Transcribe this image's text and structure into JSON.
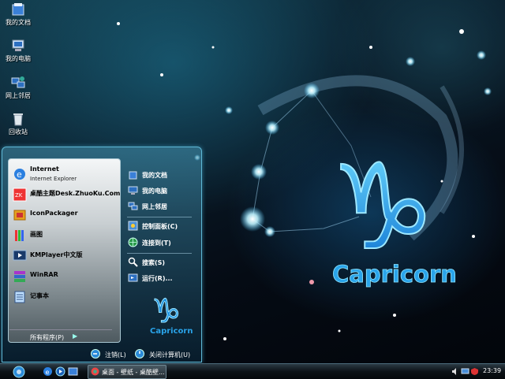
{
  "desktop": {
    "icons": [
      {
        "label": "我的文档",
        "icon": "my-documents-icon"
      },
      {
        "label": "我的电脑",
        "icon": "my-computer-icon"
      },
      {
        "label": "网上邻居",
        "icon": "network-places-icon"
      },
      {
        "label": "回收站",
        "icon": "recycle-bin-icon"
      }
    ],
    "wallpaper": {
      "title": "Capricorn",
      "glyph": "♑"
    }
  },
  "start_menu": {
    "programs": [
      {
        "name": "Internet",
        "sub": "Internet Explorer",
        "icon": "internet-explorer-icon"
      },
      {
        "name": "桌酷主题Desk.ZhuoKu.Com",
        "icon": "zhuoku-theme-icon"
      },
      {
        "name": "IconPackager",
        "icon": "iconpackager-icon"
      },
      {
        "name": "画图",
        "icon": "paint-icon"
      },
      {
        "name": "KMPlayer中文版",
        "icon": "kmplayer-icon"
      },
      {
        "name": "WinRAR",
        "icon": "winrar-icon"
      },
      {
        "name": "记事本",
        "icon": "notepad-icon"
      }
    ],
    "all_programs": "所有程序(P)",
    "right_items": [
      {
        "label": "我的文档",
        "icon": "my-documents-icon"
      },
      {
        "label": "我的电脑",
        "icon": "my-computer-icon"
      },
      {
        "label": "网上邻居",
        "icon": "network-places-icon"
      },
      {
        "label": "控制面板(C)",
        "icon": "control-panel-icon"
      },
      {
        "label": "连接到(T)",
        "icon": "connect-to-icon"
      },
      {
        "label": "搜索(S)",
        "icon": "search-icon"
      },
      {
        "label": "运行(R)...",
        "icon": "run-icon"
      }
    ],
    "logo_text": "Capricorn",
    "logoff": "注销(L)",
    "shutdown": "关闭计算机(U)"
  },
  "taskbar": {
    "task_label": "桌面 - 壁纸 - 桌酷壁...",
    "clock": "23:39"
  },
  "colors": {
    "accent": "#1fa8e8",
    "glow": "#7fe0ff"
  }
}
